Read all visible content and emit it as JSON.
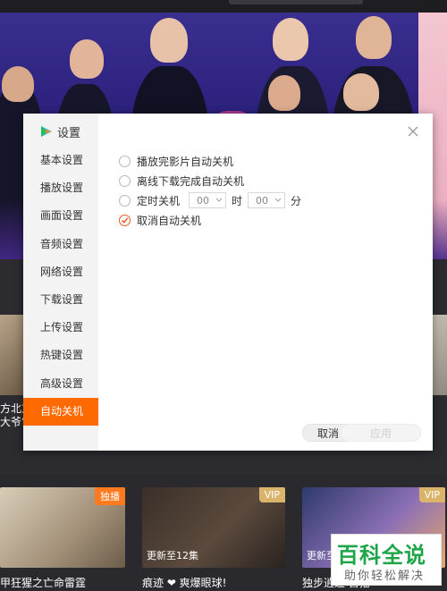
{
  "dialog": {
    "title": "设置",
    "menu": [
      {
        "label": "基本设置",
        "active": false
      },
      {
        "label": "播放设置",
        "active": false
      },
      {
        "label": "画面设置",
        "active": false
      },
      {
        "label": "音频设置",
        "active": false
      },
      {
        "label": "网络设置",
        "active": false
      },
      {
        "label": "下载设置",
        "active": false
      },
      {
        "label": "上传设置",
        "active": false
      },
      {
        "label": "热键设置",
        "active": false
      },
      {
        "label": "高级设置",
        "active": false
      },
      {
        "label": "自动关机",
        "active": true
      }
    ],
    "options": {
      "after_movie": "播放完影片自动关机",
      "after_download": "离线下载完成自动关机",
      "timed": "定时关机",
      "cancel": "取消自动关机",
      "selected": "cancel"
    },
    "timer": {
      "hour_value": "00",
      "hour_unit": "时",
      "minute_value": "00",
      "minute_unit": "分"
    },
    "buttons": {
      "cancel": "取消",
      "apply": "应用"
    },
    "colors": {
      "accent": "#ff6a00",
      "radio_checked": "#e85b20"
    }
  },
  "background": {
    "side_text_1": "方北京",
    "side_text_2": "大爷”",
    "cards": [
      {
        "badge": "独播",
        "episode": "",
        "caption": "甲狂猩之亡命雷霆"
      },
      {
        "badge": "VIP",
        "episode": "更新至12集",
        "caption": "痕迹 ❤ 爽爆眼球!"
      },
      {
        "badge": "VIP",
        "episode": "更新至",
        "caption": "独步逍遥 首播"
      }
    ],
    "watermark": {
      "title": "百科全说",
      "subtitle": "助你轻松解决"
    }
  }
}
